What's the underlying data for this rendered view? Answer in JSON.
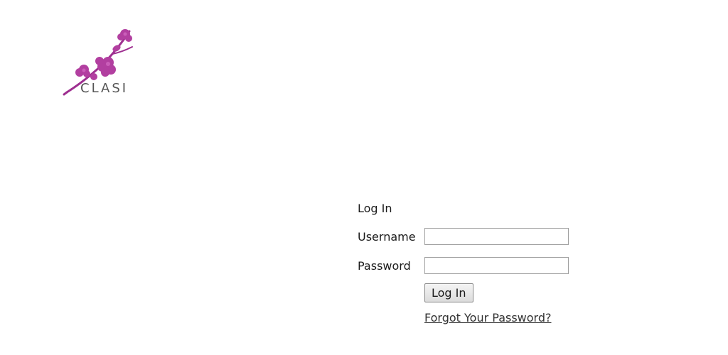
{
  "logo": {
    "text": "CLASI",
    "icon": "cherry-blossom-branch",
    "color": "#b23fa0"
  },
  "login": {
    "title": "Log In",
    "username_label": "Username",
    "username_value": "",
    "password_label": "Password",
    "password_value": "",
    "submit_label": "Log In",
    "forgot_label": "Forgot Your Password?"
  }
}
